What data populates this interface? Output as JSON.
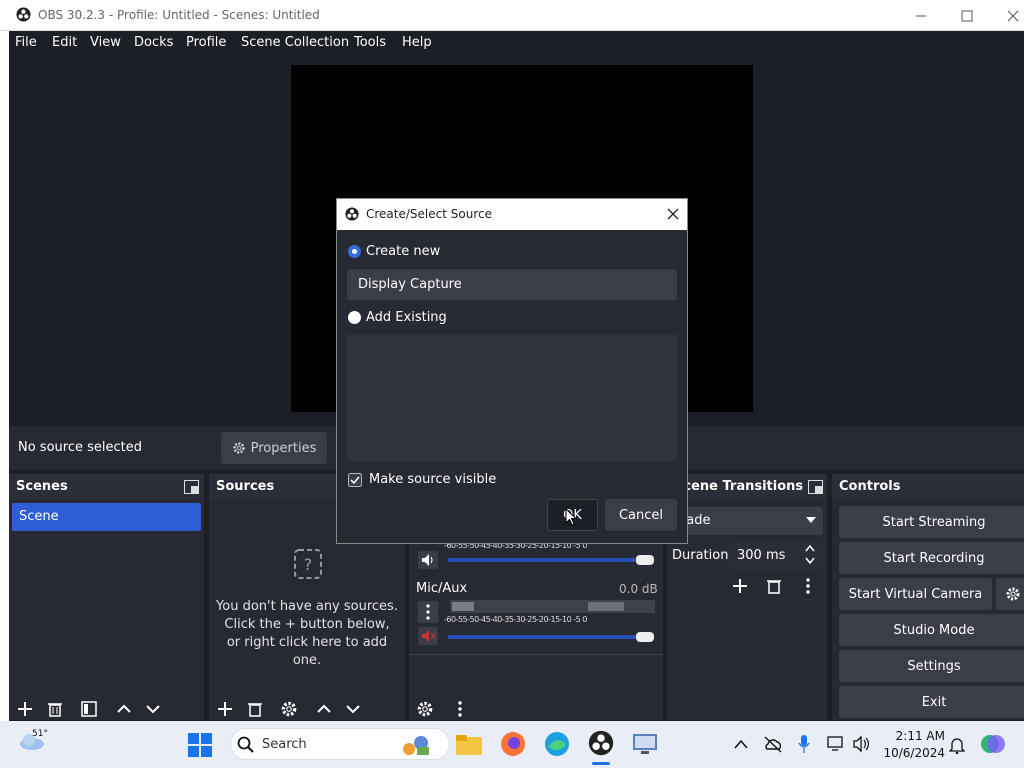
{
  "window": {
    "title": "OBS 30.2.3 - Profile: Untitled - Scenes: Untitled"
  },
  "menu": [
    "File",
    "Edit",
    "View",
    "Docks",
    "Profile",
    "Scene Collection",
    "Tools",
    "Help"
  ],
  "source_toolbar": {
    "status": "No source selected",
    "properties": "Properties"
  },
  "scenes": {
    "title": "Scenes",
    "items": [
      "Scene"
    ]
  },
  "sources": {
    "title": "Sources",
    "empty_text_1": "You don't have any sources.",
    "empty_text_2": "Click the + button below,",
    "empty_text_3": "or right click here to add one."
  },
  "mixer": {
    "ticks": [
      "-60",
      "-55",
      "-50",
      "-45",
      "-40",
      "-35",
      "-30",
      "-25",
      "-20",
      "-15",
      "-10",
      "-5",
      "0"
    ],
    "channels": [
      {
        "name": "Mic/Aux",
        "level": "0.0 dB",
        "muted": true,
        "volume": 1.0
      }
    ],
    "desktop_volume": 1.0
  },
  "transitions": {
    "title": "Scene Transitions",
    "selected": "Fade",
    "duration_label": "Duration",
    "duration": "300 ms"
  },
  "controls": {
    "title": "Controls",
    "buttons": [
      "Start Streaming",
      "Start Recording",
      "Start Virtual Camera",
      "Studio Mode",
      "Settings",
      "Exit"
    ]
  },
  "dialog": {
    "title": "Create/Select Source",
    "create_new": "Create new",
    "name_value": "Display Capture",
    "add_existing": "Add Existing",
    "make_visible": "Make source visible",
    "ok": "OK",
    "cancel": "Cancel"
  },
  "taskbar": {
    "weather": "51°",
    "search_placeholder": "Search",
    "time": "2:11 AM",
    "date": "10/6/2024"
  },
  "colors": {
    "accent": "#2f5ed4",
    "panel": "#272a33",
    "bg": "#1d1f27"
  }
}
